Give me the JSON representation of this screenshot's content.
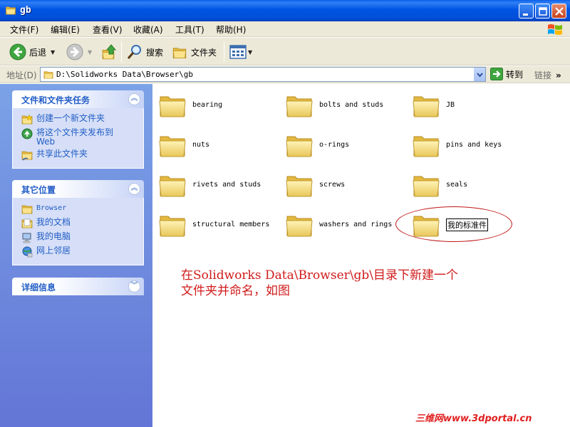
{
  "window": {
    "title": "gb"
  },
  "menu": [
    "文件(F)",
    "编辑(E)",
    "查看(V)",
    "收藏(A)",
    "工具(T)",
    "帮助(H)"
  ],
  "toolbar": {
    "back": "后退",
    "search": "搜索",
    "folders": "文件夹"
  },
  "address": {
    "label": "地址(D)",
    "path": "D:\\Solidworks Data\\Browser\\gb",
    "go": "转到",
    "links": "链接"
  },
  "tasks": {
    "title": "文件和文件夹任务",
    "items": [
      {
        "label": "创建一个新文件夹",
        "icon": "new-folder-icon"
      },
      {
        "label": "将这个文件夹发布到\nWeb",
        "icon": "publish-web-icon"
      },
      {
        "label": "共享此文件夹",
        "icon": "share-folder-icon"
      }
    ]
  },
  "places": {
    "title": "其它位置",
    "items": [
      {
        "label": "Browser",
        "icon": "folder-icon"
      },
      {
        "label": "我的文档",
        "icon": "my-documents-icon"
      },
      {
        "label": "我的电脑",
        "icon": "my-computer-icon"
      },
      {
        "label": "网上邻居",
        "icon": "network-icon"
      }
    ]
  },
  "details": {
    "title": "详细信息"
  },
  "folders": [
    "bearing",
    "bolts and studs",
    "JB",
    "nuts",
    "o-rings",
    "pins and keys",
    "rivets and studs",
    "screws",
    "seals",
    "structural members",
    "washers and rings",
    "我的标准件"
  ],
  "annotation": "在Solidworks Data\\Browser\\gb\\目录下新建一个\n文件夹并命名，如图",
  "watermark": "三维网www.3dportal.cn",
  "colors": {
    "titlebar": "#0054e3",
    "taskpane": "#6d8ee0",
    "annotation": "#d11a1a"
  }
}
